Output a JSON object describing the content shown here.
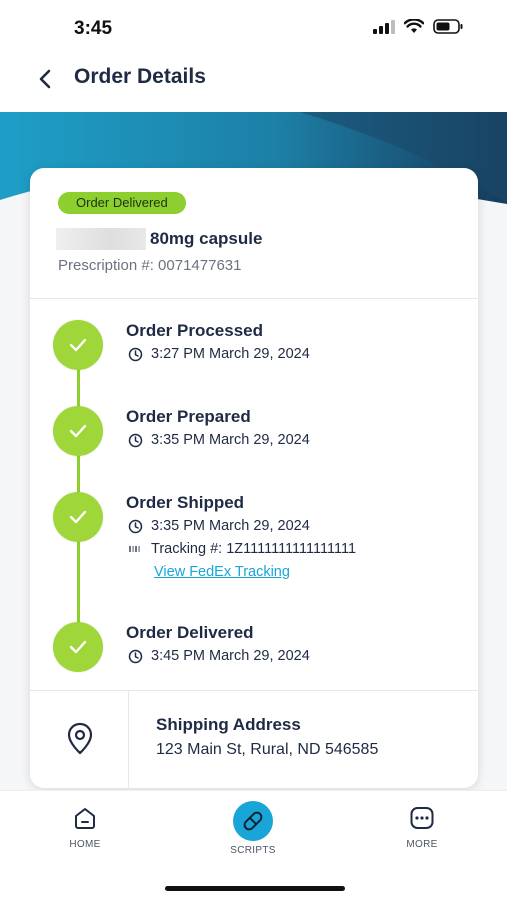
{
  "status_bar": {
    "time": "3:45"
  },
  "header": {
    "title": "Order Details"
  },
  "order": {
    "status_badge": "Order Delivered",
    "drug_name": "80mg capsule",
    "prescription_number": "Prescription #: 0071477631"
  },
  "timeline": [
    {
      "title": "Order Processed",
      "time": "3:27 PM March 29, 2024"
    },
    {
      "title": "Order Prepared",
      "time": "3:35 PM March 29, 2024"
    },
    {
      "title": "Order Shipped",
      "time": "3:35 PM March 29, 2024",
      "tracking": "Tracking #: 1Z1111111111111111",
      "tracking_link": "View FedEx Tracking"
    },
    {
      "title": "Order Delivered",
      "time": "3:45 PM March 29, 2024"
    }
  ],
  "shipping": {
    "title": "Shipping Address",
    "address": "123 Main St, Rural, ND 546585"
  },
  "bottom_nav": [
    {
      "label": "HOME",
      "icon": "home-icon"
    },
    {
      "label": "SCRIPTS",
      "icon": "pill-icon",
      "active": true
    },
    {
      "label": "MORE",
      "icon": "more-icon"
    }
  ],
  "colors": {
    "accent_green": "#8ccf2e",
    "accent_blue": "#1aa5d9",
    "text_dark": "#1f2a44"
  }
}
